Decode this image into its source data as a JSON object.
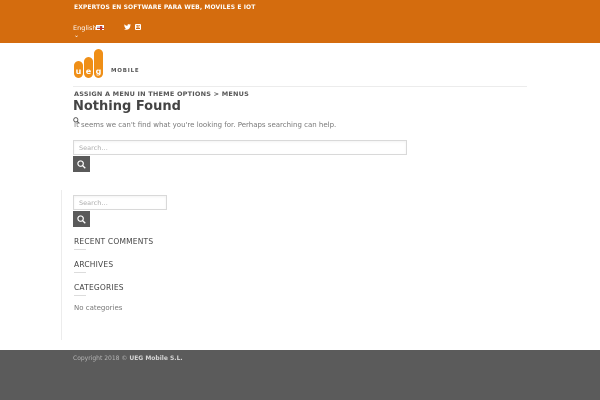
{
  "topbar": {
    "tagline": "EXPERTOS EN SOFTWARE PARA WEB, MOVILES E IOT",
    "language": "English",
    "language_flag": "uk-flag-icon",
    "chevron": "chevron-down-icon",
    "social": [
      "twitter-icon",
      "linkedin-icon"
    ],
    "background": "#d46c0e"
  },
  "logo": {
    "word": "MOBILE",
    "icon": "ueg-logo-bars",
    "color": "#ef8f17"
  },
  "nav": {
    "menu_hint": "ASSIGN A MENU IN THEME OPTIONS > MENUS"
  },
  "main": {
    "title": "Nothing Found",
    "lead": "It seems we can't find what you're looking for. Perhaps searching can help.",
    "search_placeholder": "Search…"
  },
  "sidebar": {
    "search_placeholder": "Search…",
    "widgets": [
      {
        "title": "RECENT COMMENTS"
      },
      {
        "title": "ARCHIVES"
      },
      {
        "title": "CATEGORIES",
        "body": "No categories"
      }
    ]
  },
  "footer": {
    "copyright_prefix": "Copyright 2018 ©",
    "company": "UEG Mobile S.L.",
    "background": "#5b5b5b"
  }
}
